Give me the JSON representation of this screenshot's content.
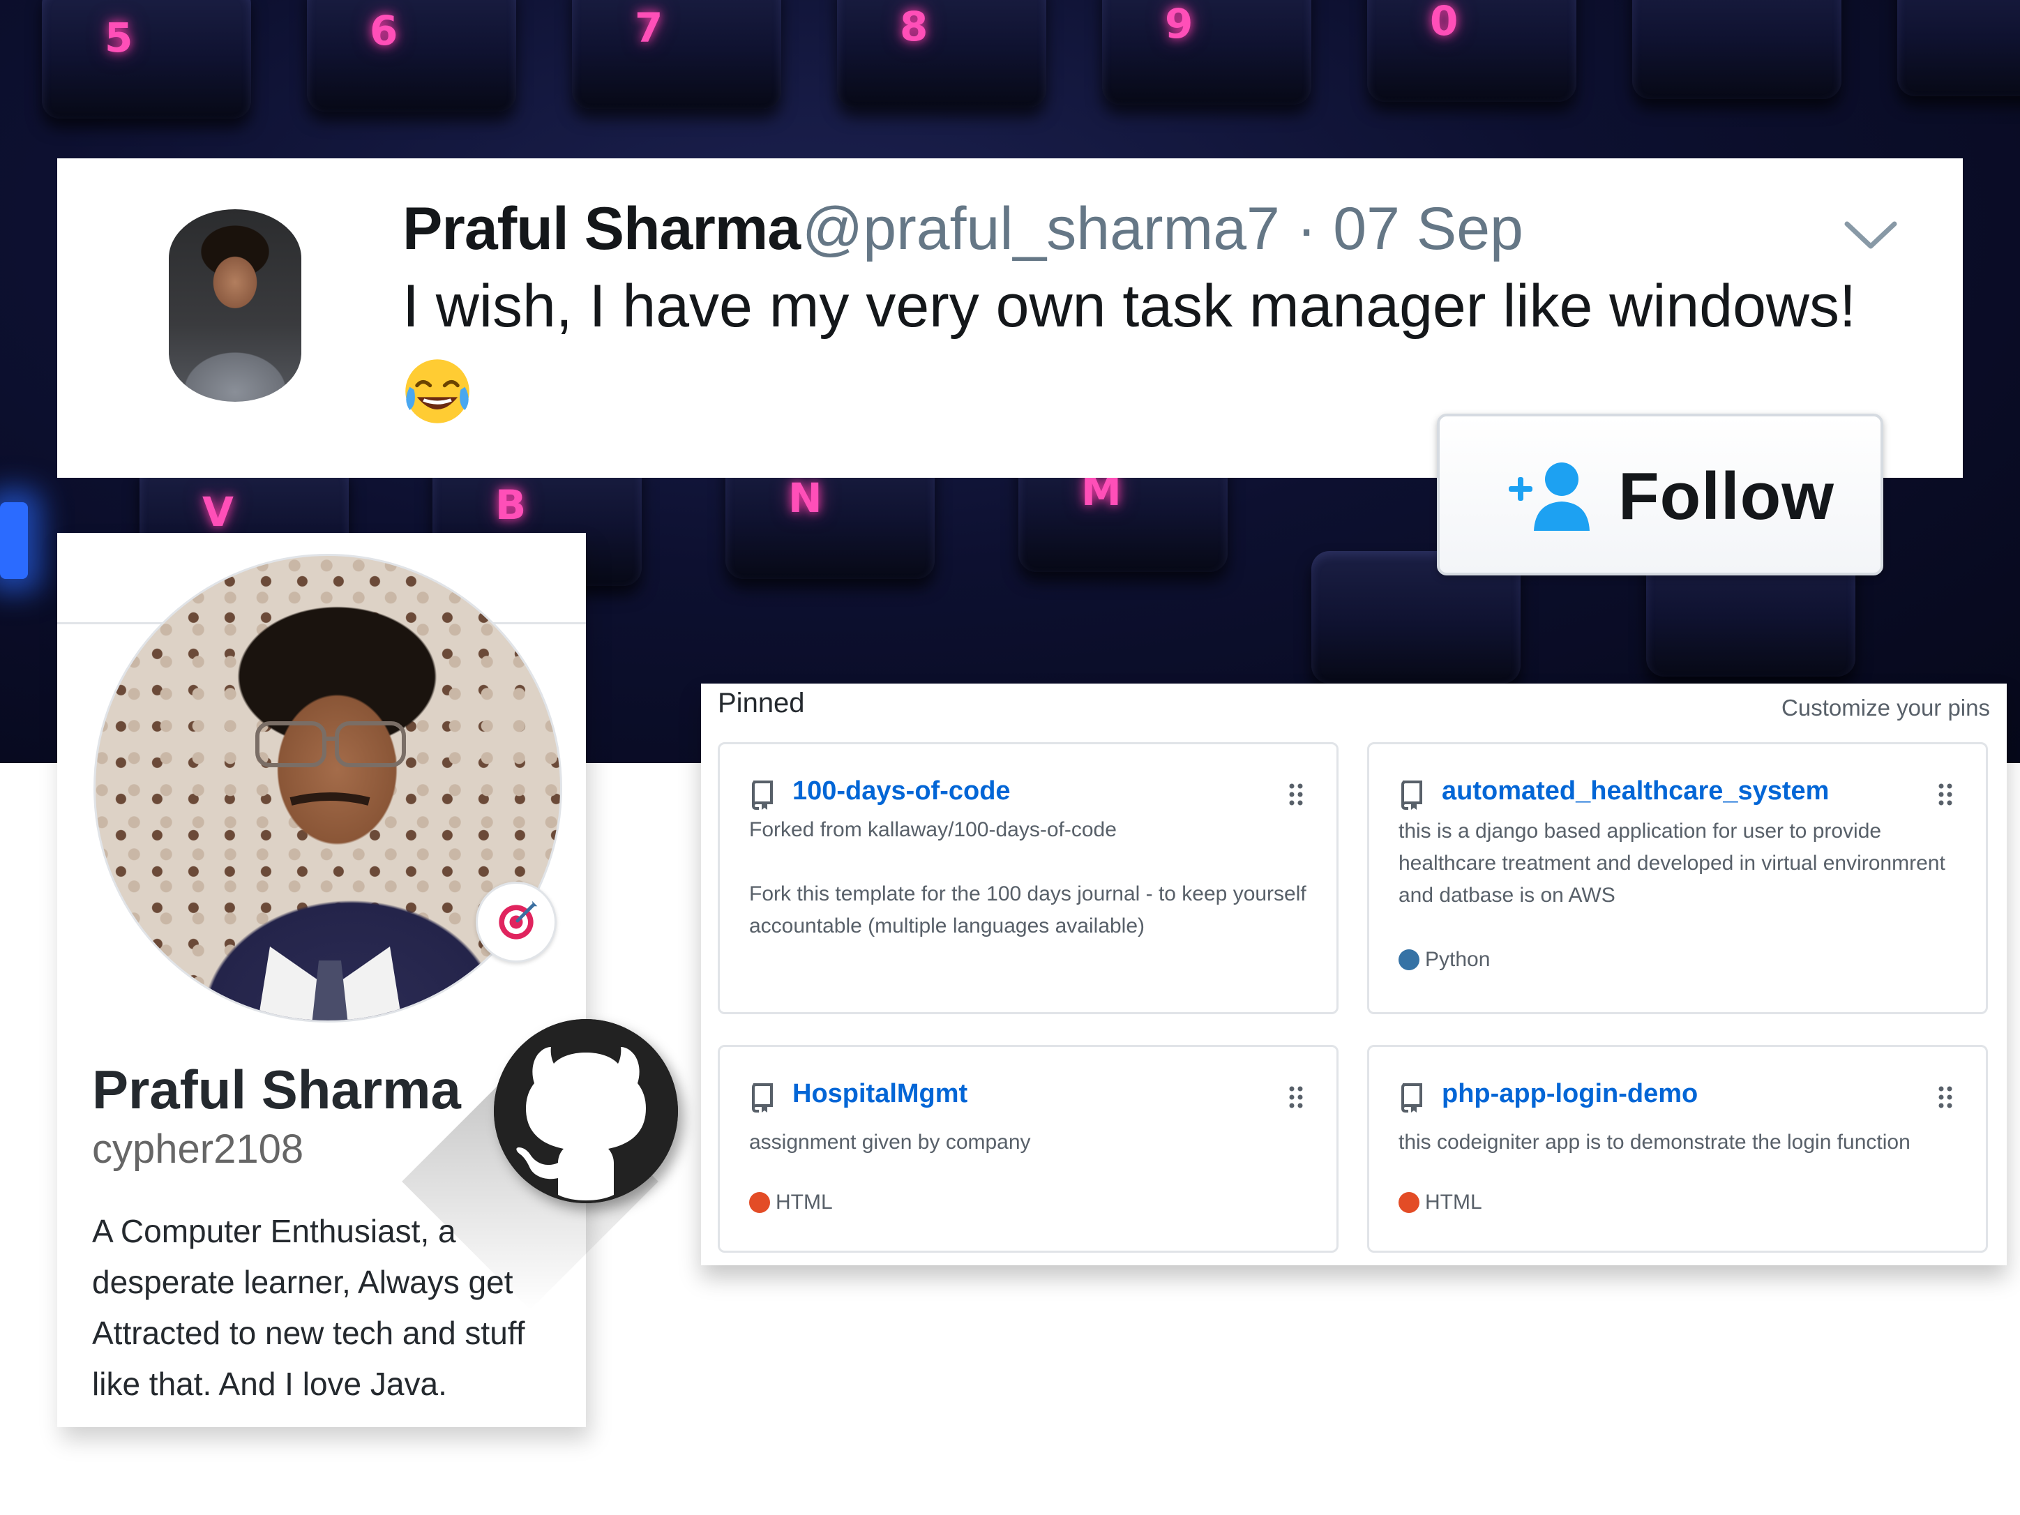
{
  "tweet": {
    "name": "Praful Sharma",
    "handle": "@praful_sharma7",
    "separator": " · ",
    "date": "07 Sep",
    "text": "I wish, I have my very own task manager like windows!",
    "emoji": "face-with-tears-of-joy"
  },
  "follow_button": {
    "label": "Follow",
    "icon": "add-user-icon"
  },
  "profile": {
    "name": "Praful Sharma",
    "username": "cypher2108",
    "bio": "A Computer Enthusiast, a desperate learner, Always get Attracted to new tech and stuff like that. And I love Java.",
    "status_icon": "dart-target-icon"
  },
  "keyboard_keys": [
    "5",
    "6",
    "7",
    "8",
    "9",
    "0",
    "V",
    "B",
    "N",
    "M"
  ],
  "pinned": {
    "title": "Pinned",
    "customize_label": "Customize your pins",
    "repos": [
      {
        "name": "100-days-of-code",
        "fork_note": "Forked from kallaway/100-days-of-code",
        "description": "Fork this template for the 100 days journal - to keep yourself accountable (multiple languages available)",
        "language": "",
        "language_color": ""
      },
      {
        "name": "automated_healthcare_system",
        "fork_note": "",
        "description": "this is a django based application for user to provide healthcare treatment and developed in virtual environmrent and datbase is on AWS",
        "language": "Python",
        "language_color": "#3572A5"
      },
      {
        "name": "HospitalMgmt",
        "fork_note": "",
        "description": "assignment given by company",
        "language": "HTML",
        "language_color": "#e34c26"
      },
      {
        "name": "php-app-login-demo",
        "fork_note": "",
        "description": "this codeigniter app is to demonstrate the login function",
        "language": "HTML",
        "language_color": "#e34c26"
      }
    ]
  },
  "colors": {
    "link_blue": "#0366d6",
    "twitter_blue": "#1da1f2",
    "neon_pink": "#ff4fb8"
  }
}
